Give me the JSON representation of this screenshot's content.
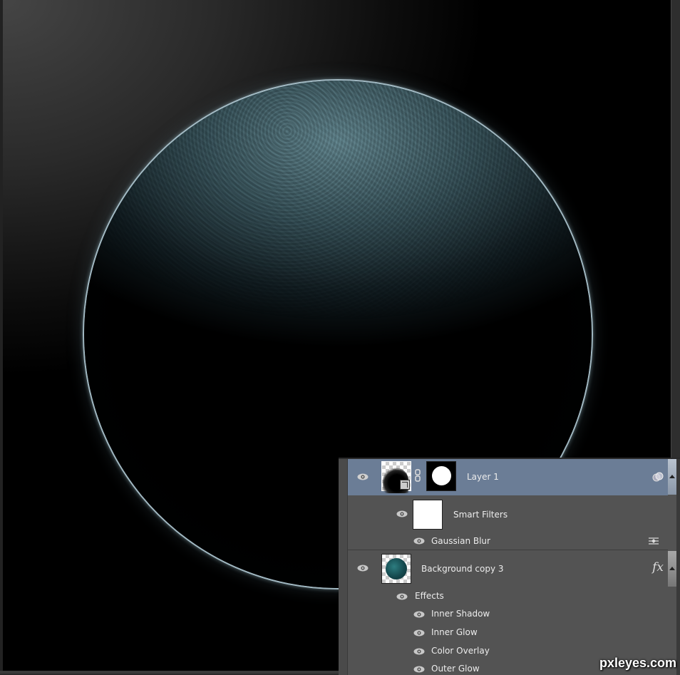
{
  "app": "Photoshop",
  "canvas": {
    "subject": "dark planet with icy blue-teal textured surface and rim glow",
    "rim_color": "#b4cdd7",
    "surface_color": "#6e96a0"
  },
  "layers_panel": {
    "selected_color": "#6b7d96",
    "background_color": "#535353",
    "layers": [
      {
        "name": "Layer 1",
        "selected": true,
        "visible": true,
        "thumbnail": "smart-object-thumbnail",
        "mask": "circle-mask",
        "badge_icon": "blending-options-icon",
        "smart_filters": {
          "label": "Smart Filters",
          "visible": true,
          "filters": [
            {
              "name": "Gaussian Blur",
              "visible": true,
              "options_icon": "filter-blending-options-icon"
            }
          ]
        }
      },
      {
        "name": "Background copy 3",
        "selected": false,
        "visible": true,
        "thumbnail": "planet-texture-thumbnail",
        "badge_icon": "fx-icon",
        "badge_text": "fx",
        "effects": {
          "label": "Effects",
          "visible": true,
          "items": [
            {
              "name": "Inner Shadow",
              "visible": true
            },
            {
              "name": "Inner Glow",
              "visible": true
            },
            {
              "name": "Color Overlay",
              "visible": true
            },
            {
              "name": "Outer Glow",
              "visible": true
            }
          ]
        }
      }
    ]
  },
  "watermark": "pxleyes.com"
}
